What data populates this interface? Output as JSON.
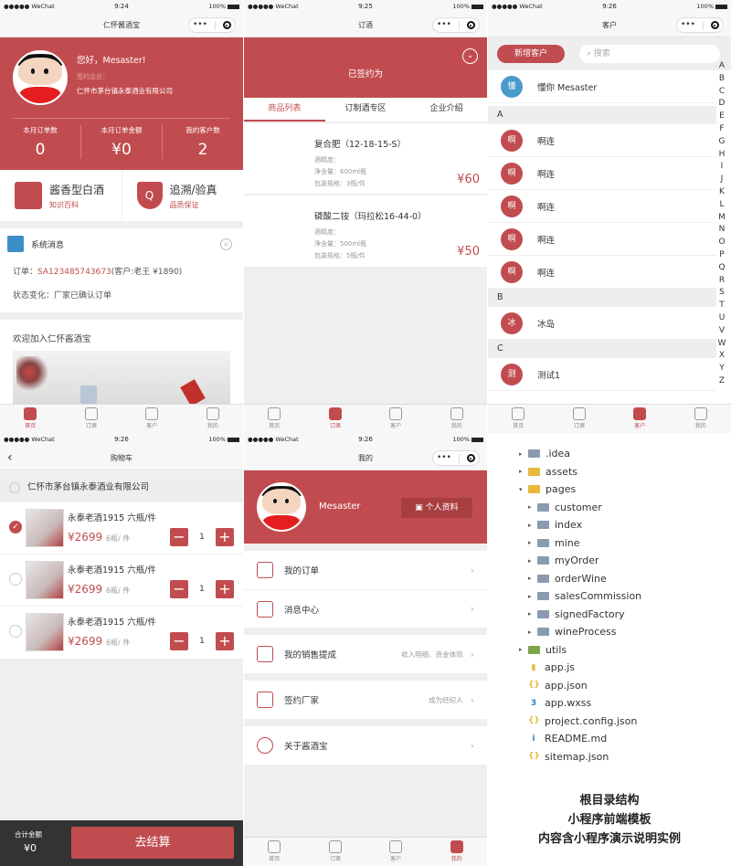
{
  "status": {
    "carrier": "●●●●● WeChat",
    "battery": "100%"
  },
  "home": {
    "time": "9:24",
    "title": "仁怀酱酒宝",
    "greeting": "您好，Mesaster!",
    "company_label": "签约企业：",
    "company": "仁怀市茅台镇永泰酒业有限公司",
    "stats": [
      {
        "label": "本月订单数",
        "value": "0"
      },
      {
        "label": "本月订单金额",
        "value": "¥0"
      },
      {
        "label": "我的客户数",
        "value": "2"
      }
    ],
    "feature1": {
      "title": "酱香型白酒",
      "sub": "知识百科"
    },
    "feature2": {
      "title": "追溯/验真",
      "sub": "品质保证",
      "icon_letter": "Q"
    },
    "notice_title": "系统消息",
    "notice_order_prefix": "订单：",
    "notice_order_no": "SA123485743673",
    "notice_order_suffix": "(客户:老王 ¥1890)",
    "notice_status": "状态变化：厂家已确认订单",
    "welcome": "欢迎加入仁怀酱酒宝"
  },
  "tabs": [
    {
      "label": "首页",
      "icon": "home-icon"
    },
    {
      "label": "订酒",
      "icon": "bottle-icon"
    },
    {
      "label": "客户",
      "icon": "user-icon"
    },
    {
      "label": "我的",
      "icon": "me-icon"
    }
  ],
  "order": {
    "time": "9:25",
    "title": "订酒",
    "signed": "已签约为",
    "tabs": [
      "商品列表",
      "订制酒专区",
      "企业介绍"
    ],
    "products": [
      {
        "name": "复合肥（12-18-15-S）",
        "l1": "酒精度：",
        "l2": "净含量：600ml瓶",
        "l3": "包装规格：3瓶/件",
        "price": "¥60"
      },
      {
        "name": "磷酸二铵（玛拉松16-44-0）",
        "l1": "酒精度：",
        "l2": "净含量：500ml瓶",
        "l3": "包装规格：5瓶/件",
        "price": "¥50"
      }
    ]
  },
  "customer": {
    "time": "9:26",
    "title": "客户",
    "add_button": "新增客户",
    "search_placeholder": "搜索",
    "me": {
      "avatar": "懂",
      "name": "懂你   Mesaster"
    },
    "groups": [
      {
        "letter": "A",
        "items": [
          {
            "avatar": "啊",
            "name": "啊连"
          },
          {
            "avatar": "啊",
            "name": "啊连"
          },
          {
            "avatar": "啊",
            "name": "啊连"
          },
          {
            "avatar": "啊",
            "name": "啊连"
          },
          {
            "avatar": "啊",
            "name": "啊连"
          }
        ]
      },
      {
        "letter": "B",
        "items": [
          {
            "avatar": "冰",
            "name": "冰岛"
          }
        ]
      },
      {
        "letter": "C",
        "items": [
          {
            "avatar": "测",
            "name": "测试1"
          }
        ]
      }
    ],
    "index": [
      "A",
      "B",
      "C",
      "D",
      "E",
      "F",
      "G",
      "H",
      "I",
      "J",
      "K",
      "L",
      "M",
      "N",
      "O",
      "P",
      "Q",
      "R",
      "S",
      "T",
      "U",
      "V",
      "W",
      "X",
      "Y",
      "Z"
    ]
  },
  "cart": {
    "time": "9:26",
    "title": "购物车",
    "shop": "仁怀市茅台镇永泰酒业有限公司",
    "items": [
      {
        "name": "永泰老酒1915 六瓶/件",
        "price": "¥2699",
        "unit": "6瓶/ 件",
        "qty": "1"
      },
      {
        "name": "永泰老酒1915 六瓶/件",
        "price": "¥2699",
        "unit": "6瓶/ 件",
        "qty": "1"
      },
      {
        "name": "永泰老酒1915 六瓶/件",
        "price": "¥2699",
        "unit": "6瓶/ 件",
        "qty": "1"
      }
    ],
    "total_label": "合计金额",
    "total": "¥0",
    "checkout": "去结算"
  },
  "mine": {
    "time": "9:26",
    "title": "我的",
    "name": "Mesaster",
    "profile_button": "个人资料",
    "menu": [
      {
        "label": "我的订单",
        "sub": ""
      },
      {
        "label": "消息中心",
        "sub": ""
      },
      {
        "label": "我的销售提成",
        "sub": "收入明细、资金体现"
      },
      {
        "label": "签约厂家",
        "sub": "成为经纪人"
      },
      {
        "label": "关于酱酒宝",
        "sub": ""
      }
    ]
  },
  "tree": {
    "items": [
      {
        "name": ".idea",
        "level": 0,
        "type": "folder",
        "arrow": "▸"
      },
      {
        "name": "assets",
        "level": 0,
        "type": "folder-y",
        "arrow": "▸"
      },
      {
        "name": "pages",
        "level": 0,
        "type": "folder-y",
        "arrow": "▾"
      },
      {
        "name": "customer",
        "level": 1,
        "type": "folder",
        "arrow": "▸"
      },
      {
        "name": "index",
        "level": 1,
        "type": "folder",
        "arrow": "▸"
      },
      {
        "name": "mine",
        "level": 1,
        "type": "folder",
        "arrow": "▸"
      },
      {
        "name": "myOrder",
        "level": 1,
        "type": "folder",
        "arrow": "▸"
      },
      {
        "name": "orderWine",
        "level": 1,
        "type": "folder",
        "arrow": "▸"
      },
      {
        "name": "salesCommission",
        "level": 1,
        "type": "folder",
        "arrow": "▸"
      },
      {
        "name": "signedFactory",
        "level": 1,
        "type": "folder",
        "arrow": "▸"
      },
      {
        "name": "wineProcess",
        "level": 1,
        "type": "folder",
        "arrow": "▸"
      },
      {
        "name": "utils",
        "level": 0,
        "type": "folder-g",
        "arrow": "▸"
      },
      {
        "name": "app.js",
        "level": 0,
        "type": "js",
        "arrow": ""
      },
      {
        "name": "app.json",
        "level": 0,
        "type": "json",
        "arrow": ""
      },
      {
        "name": "app.wxss",
        "level": 0,
        "type": "css",
        "arrow": ""
      },
      {
        "name": "project.config.json",
        "level": 0,
        "type": "json",
        "arrow": ""
      },
      {
        "name": "README.md",
        "level": 0,
        "type": "info",
        "arrow": ""
      },
      {
        "name": "sitemap.json",
        "level": 0,
        "type": "json",
        "arrow": ""
      }
    ],
    "caption": [
      "根目录结构",
      "小程序前端模板",
      "内容含小程序演示说明实例"
    ]
  }
}
